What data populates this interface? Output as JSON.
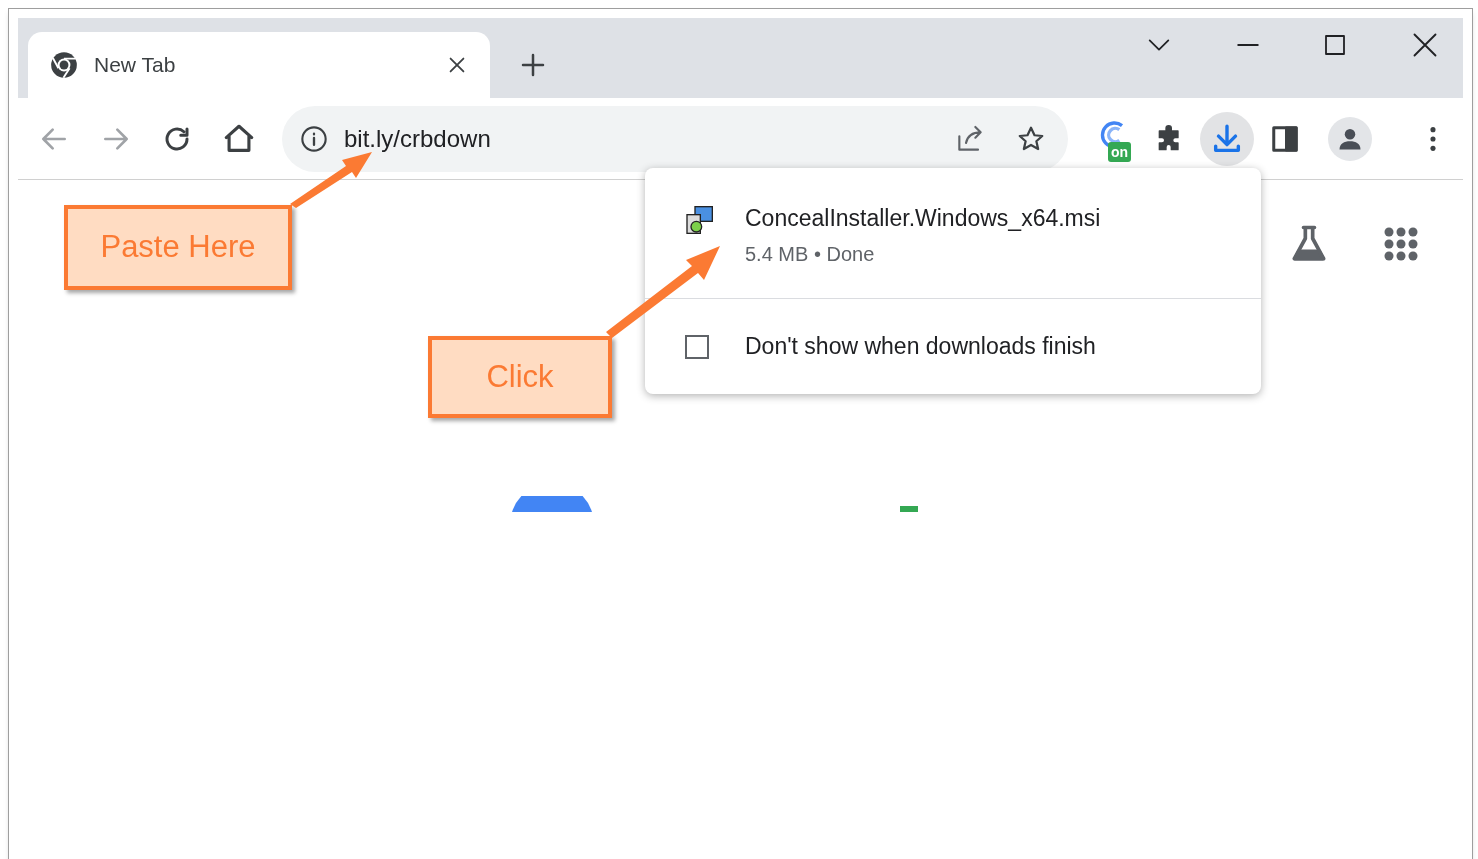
{
  "tabs": [
    {
      "title": "New Tab",
      "selected": true
    }
  ],
  "address_bar": {
    "url": "bit.ly/crbdown"
  },
  "toolbar": {
    "extension_badge": "on",
    "downloads_active": true
  },
  "download_panel": {
    "file_name": "ConcealInstaller.Windows_x64.msi",
    "status": "5.4 MB • Done",
    "option": {
      "label": "Don't show when downloads finish",
      "checked": false
    }
  },
  "callouts": [
    {
      "text": "Paste Here"
    },
    {
      "text": "Click"
    }
  ]
}
